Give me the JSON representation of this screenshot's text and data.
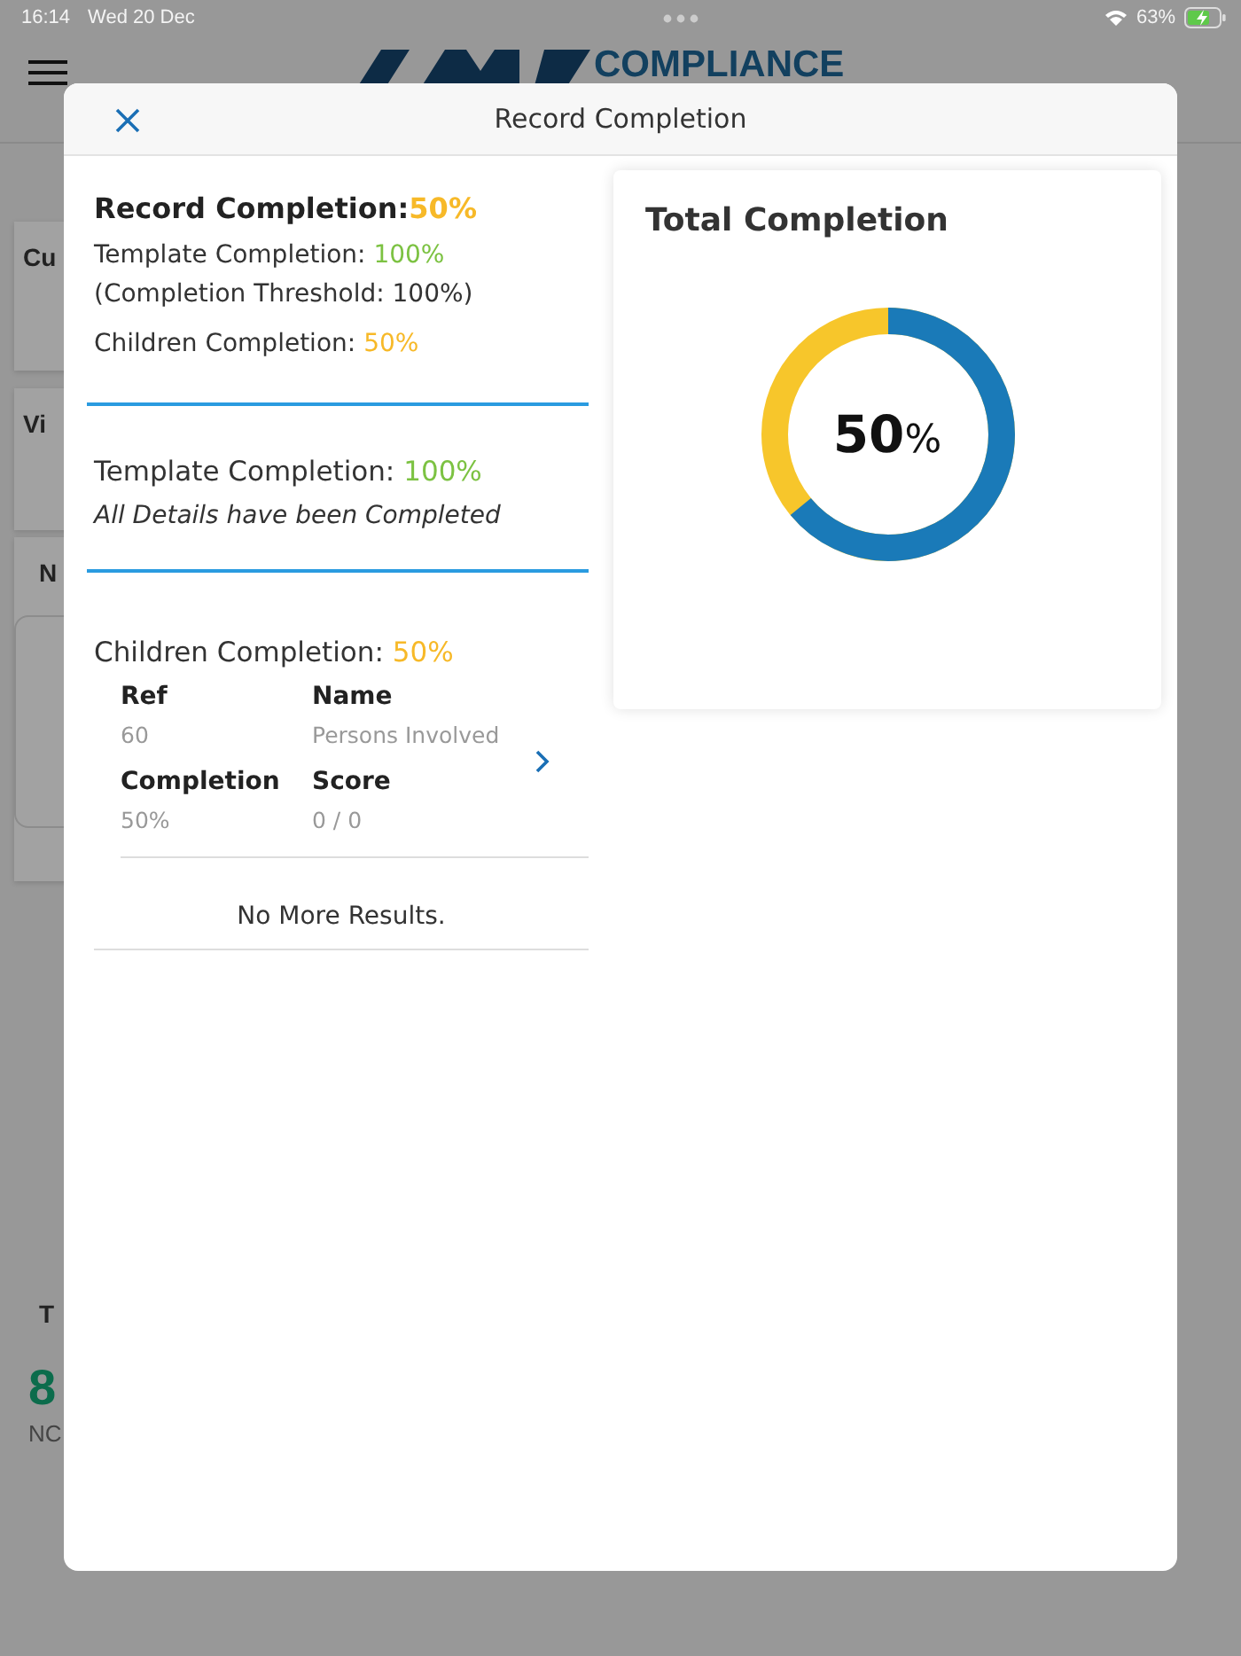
{
  "status_bar": {
    "time": "16:14",
    "date": "Wed 20 Dec",
    "battery": "63%"
  },
  "app_header": {
    "logo_text": "COMPLIANCE"
  },
  "background_cards": [
    {
      "text": "Cu"
    },
    {
      "text": "Vi"
    },
    {
      "text": "N"
    }
  ],
  "background_stat": {
    "label": "T",
    "value": "8",
    "caption": "NC"
  },
  "dialog": {
    "title": "Record Completion",
    "summary": {
      "label": "Record Completion:",
      "value": "50%",
      "color": "#f7b928",
      "lines": [
        {
          "label": "Template Completion: ",
          "value": "100%",
          "color": "#7cc242",
          "note": "(Completion Threshold: 100%)"
        },
        {
          "label": "Children Completion: ",
          "value": "50%",
          "color": "#f7b928"
        }
      ]
    },
    "template_section": {
      "label": "Template Completion: ",
      "value": "100%",
      "color": "#7cc242",
      "note": "All Details have been Completed"
    },
    "children_section": {
      "label": "Children Completion: ",
      "value": "50%",
      "color": "#f7b928",
      "items": [
        {
          "fields": [
            {
              "label": "Ref",
              "value": "60"
            },
            {
              "label": "Name",
              "value": "Persons Involved"
            },
            {
              "label": "Completion",
              "value": "50%"
            },
            {
              "label": "Score",
              "value": "0 / 0"
            }
          ]
        }
      ],
      "footer": "No More Results."
    },
    "total": {
      "title": "Total Completion",
      "label": "**50**%",
      "level": 0.64
    }
  }
}
